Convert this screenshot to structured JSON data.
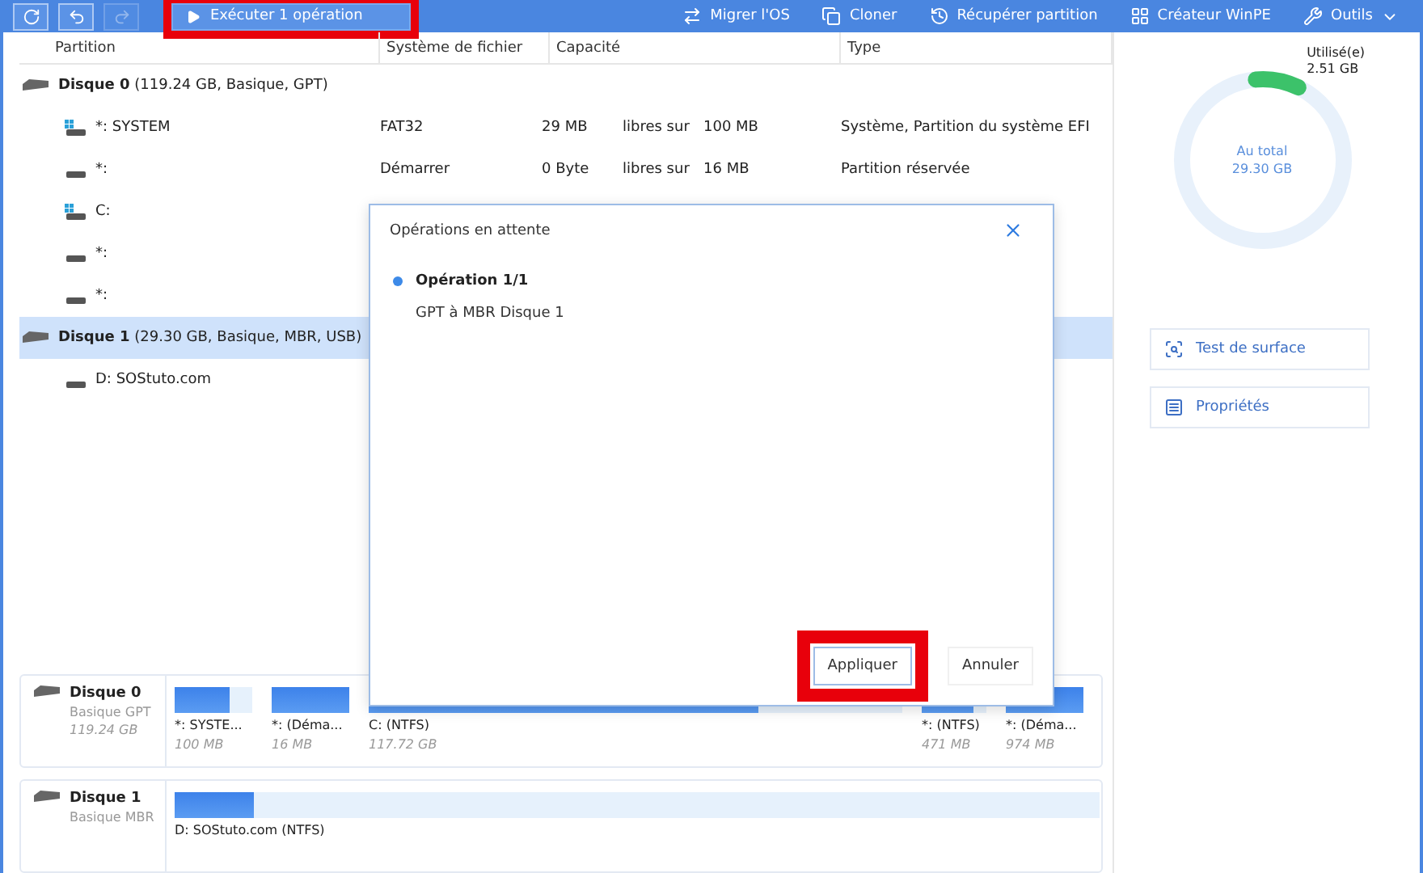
{
  "toolbar": {
    "history_buttons": [
      {
        "disabled": false
      },
      {
        "disabled": false
      },
      {
        "disabled": true
      }
    ],
    "execute_button": {
      "label": "Exécuter 1 opération",
      "highlighted": true
    },
    "tools": [
      {
        "label": "Migrer l'OS",
        "kind": "action"
      },
      {
        "label": "Cloner",
        "kind": "action"
      },
      {
        "label": "Récupérer partition",
        "kind": "action"
      },
      {
        "label": "Créateur WinPE",
        "kind": "action"
      },
      {
        "label": "Outils",
        "kind": "menu"
      }
    ]
  },
  "table": {
    "columns": [
      "Partition",
      "Système de fichier",
      "Capacité",
      "Type"
    ],
    "disks": [
      {
        "name": "Disque 0",
        "details": "(119.24 GB, Basique, GPT)",
        "selected": false,
        "partitions": [
          {
            "name": "*: SYSTEM",
            "kind": "system",
            "file_system": "FAT32",
            "free": "29 MB",
            "free_label": "libres sur",
            "total": "100 MB",
            "type": "Système, Partition du système EFI"
          },
          {
            "name": "*:",
            "kind": "plain",
            "file_system": "Démarrer",
            "free": "0 Byte",
            "free_label": "libres sur",
            "total": "16 MB",
            "type": "Partition réservée"
          },
          {
            "name": "C:",
            "kind": "system"
          },
          {
            "name": "*:",
            "kind": "plain"
          },
          {
            "name": "*:",
            "kind": "plain"
          }
        ]
      },
      {
        "name": "Disque 1",
        "details": "(29.30 GB, Basique, MBR, USB)",
        "selected": true,
        "partitions": [
          {
            "name": "D: SOStuto.com",
            "kind": "plain"
          }
        ]
      }
    ]
  },
  "side_panel": {
    "used_label": "Utilisé(e)",
    "used": "2.51 GB",
    "total_label": "Au total",
    "total": "29.30 GB",
    "level": 0.086,
    "buttons": [
      {
        "label": "Test de surface",
        "kind": "surface"
      },
      {
        "label": "Propriétés",
        "kind": "properties"
      }
    ]
  },
  "disk_map": [
    {
      "name": "Disque 0",
      "scheme": "Basique GPT",
      "size": "119.24 GB",
      "segments": [
        {
          "label": "*: SYSTE...",
          "size": "100 MB",
          "level": 0.7
        },
        {
          "label": "*:  (Déma...",
          "size": "16 MB",
          "level": 1
        },
        {
          "label": "C:  (NTFS)",
          "size": "117.72 GB",
          "level": 0.73
        },
        {
          "label": "*:  (NTFS)",
          "size": "471 MB",
          "level": 0.8
        },
        {
          "label": "*:  (Déma...",
          "size": "974 MB",
          "level": 1
        }
      ]
    },
    {
      "name": "Disque 1",
      "scheme": "Basique MBR",
      "segments": [
        {
          "label": "D: SOStuto.com (NTFS)",
          "level": 0.086
        }
      ]
    }
  ],
  "dialog": {
    "title": "Opérations en attente",
    "operation_title": "Opération 1/1",
    "operation": "GPT à MBR Disque 1",
    "buttons": [
      {
        "label": "Appliquer",
        "highlighted": true
      },
      {
        "label": "Annuler",
        "highlighted": false
      }
    ]
  }
}
